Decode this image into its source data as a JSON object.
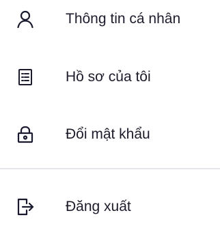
{
  "menu": {
    "items": [
      {
        "label": "Thông tin cá nhân",
        "icon": "person-icon"
      },
      {
        "label": "Hồ sơ của tôi",
        "icon": "document-list-icon"
      },
      {
        "label": "Đổi mật khẩu",
        "icon": "lock-icon"
      }
    ],
    "logout": {
      "label": "Đăng xuất",
      "icon": "logout-icon"
    }
  },
  "colors": {
    "text": "#1c1c2b",
    "icon": "#1a1a2e",
    "divider": "#e6e6ea"
  }
}
